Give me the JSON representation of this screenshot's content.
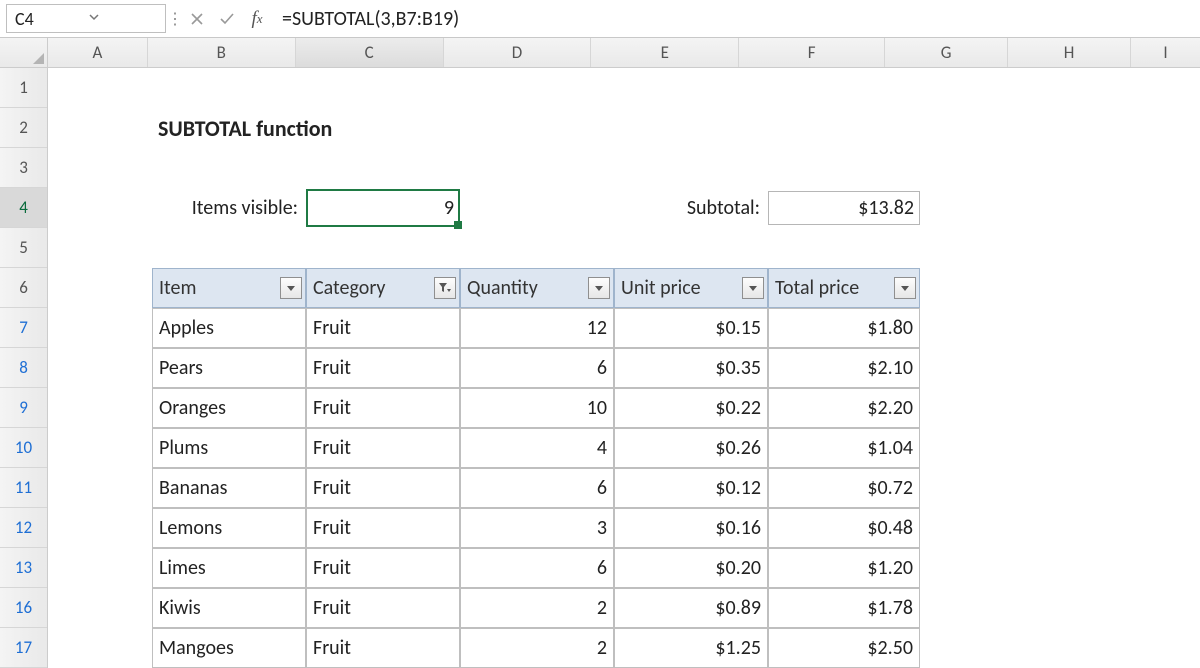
{
  "namebox": "C4",
  "formula": "=SUBTOTAL(3,B7:B19)",
  "columns": [
    "A",
    "B",
    "C",
    "D",
    "E",
    "F",
    "G",
    "H",
    "I"
  ],
  "rows": [
    "1",
    "2",
    "3",
    "4",
    "5",
    "6",
    "7",
    "8",
    "9",
    "10",
    "11",
    "12",
    "13",
    "16",
    "17"
  ],
  "title": "SUBTOTAL function",
  "items_visible_label": "Items visible:",
  "items_visible_value": "9",
  "subtotal_label": "Subtotal:",
  "subtotal_value": "$13.82",
  "headers": {
    "item": "Item",
    "category": "Category",
    "quantity": "Quantity",
    "unit_price": "Unit price",
    "total_price": "Total price"
  },
  "data": [
    {
      "item": "Apples",
      "category": "Fruit",
      "quantity": "12",
      "unit_price": "$0.15",
      "total_price": "$1.80"
    },
    {
      "item": "Pears",
      "category": "Fruit",
      "quantity": "6",
      "unit_price": "$0.35",
      "total_price": "$2.10"
    },
    {
      "item": "Oranges",
      "category": "Fruit",
      "quantity": "10",
      "unit_price": "$0.22",
      "total_price": "$2.20"
    },
    {
      "item": "Plums",
      "category": "Fruit",
      "quantity": "4",
      "unit_price": "$0.26",
      "total_price": "$1.04"
    },
    {
      "item": "Bananas",
      "category": "Fruit",
      "quantity": "6",
      "unit_price": "$0.12",
      "total_price": "$0.72"
    },
    {
      "item": "Lemons",
      "category": "Fruit",
      "quantity": "3",
      "unit_price": "$0.16",
      "total_price": "$0.48"
    },
    {
      "item": "Limes",
      "category": "Fruit",
      "quantity": "6",
      "unit_price": "$0.20",
      "total_price": "$1.20"
    },
    {
      "item": "Kiwis",
      "category": "Fruit",
      "quantity": "2",
      "unit_price": "$0.89",
      "total_price": "$1.78"
    },
    {
      "item": "Mangoes",
      "category": "Fruit",
      "quantity": "2",
      "unit_price": "$1.25",
      "total_price": "$2.50"
    }
  ]
}
